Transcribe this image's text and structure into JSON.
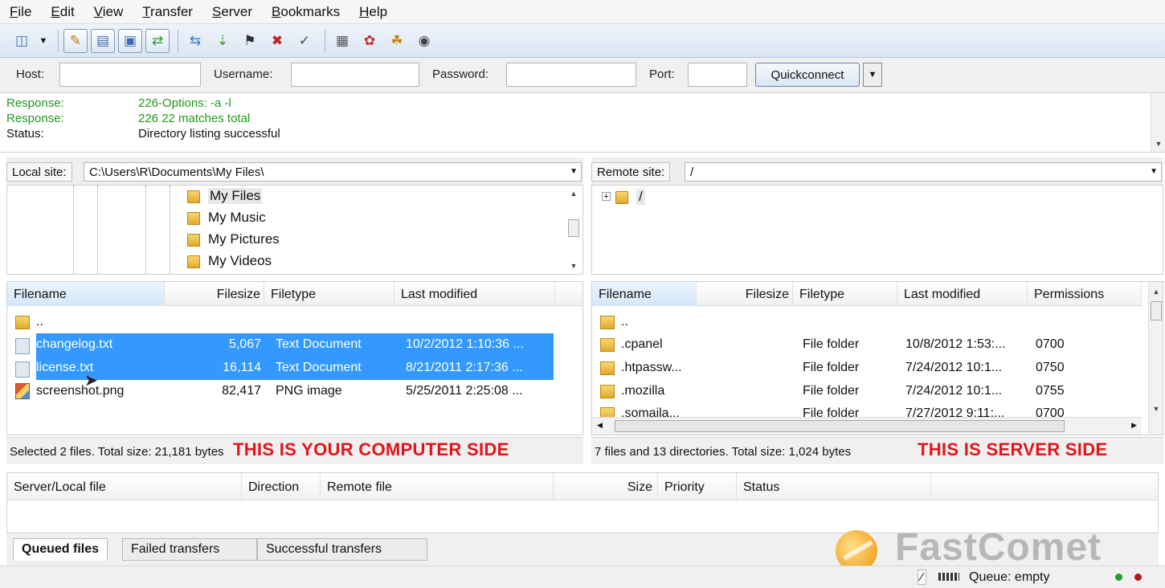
{
  "menu": [
    "File",
    "Edit",
    "View",
    "Transfer",
    "Server",
    "Bookmarks",
    "Help"
  ],
  "toolbar": {
    "icons": [
      "site-manager-icon",
      "dropdown-arrow-icon",
      "toggle-log-icon",
      "toggle-local-tree-icon",
      "toggle-remote-tree-icon",
      "toggle-queue-icon",
      "refresh-icon",
      "process-queue-icon",
      "cancel-icon",
      "disconnect-icon",
      "reconnect-icon",
      "directory-comparison-icon",
      "sync-browse-icon",
      "filter-icon",
      "search-icon"
    ]
  },
  "quickconnect": {
    "host_label": "Host:",
    "username_label": "Username:",
    "password_label": "Password:",
    "port_label": "Port:",
    "host_value": "",
    "username_value": "",
    "password_value": "",
    "port_value": "",
    "button_label": "Quickconnect"
  },
  "log": [
    {
      "type": "Response:",
      "message": "226-Options: -a -l",
      "color": "#1f9a1f"
    },
    {
      "type": "Response:",
      "message": "226 22 matches total",
      "color": "#1f9a1f"
    },
    {
      "type": "Status:",
      "message": "Directory listing successful",
      "color": "#111111"
    }
  ],
  "local": {
    "site_label": "Local site:",
    "path": "C:\\Users\\R\\Documents\\My Files\\",
    "tree": [
      "My Files",
      "My Music",
      "My Pictures",
      "My Videos"
    ],
    "columns": [
      "Filename",
      "Filesize",
      "Filetype",
      "Last modified"
    ],
    "files": [
      {
        "name": "..",
        "size": "",
        "type": "",
        "modified": ""
      },
      {
        "name": "changelog.txt",
        "size": "5,067",
        "type": "Text Document",
        "modified": "10/2/2012 1:10:36 ..."
      },
      {
        "name": "license.txt",
        "size": "16,114",
        "type": "Text Document",
        "modified": "8/21/2011 2:17:36 ..."
      },
      {
        "name": "screenshot.png",
        "size": "82,417",
        "type": "PNG image",
        "modified": "5/25/2011 2:25:08 ..."
      }
    ],
    "status": "Selected 2 files. Total size: 21,181 bytes",
    "note": "THIS IS YOUR COMPUTER SIDE"
  },
  "remote": {
    "site_label": "Remote site:",
    "path": "/",
    "tree_root": "/",
    "columns": [
      "Filename",
      "Filesize",
      "Filetype",
      "Last modified",
      "Permissions"
    ],
    "files": [
      {
        "name": "..",
        "size": "",
        "type": "",
        "modified": "",
        "perms": ""
      },
      {
        "name": ".cpanel",
        "size": "",
        "type": "File folder",
        "modified": "10/8/2012 1:53:...",
        "perms": "0700"
      },
      {
        "name": ".htpassw...",
        "size": "",
        "type": "File folder",
        "modified": "7/24/2012 10:1...",
        "perms": "0750"
      },
      {
        "name": ".mozilla",
        "size": "",
        "type": "File folder",
        "modified": "7/24/2012 10:1...",
        "perms": "0755"
      },
      {
        "name": ".somaila...",
        "size": "",
        "type": "File folder",
        "modified": "7/27/2012 9:11:...",
        "perms": "0700"
      }
    ],
    "status": "7 files and 13 directories. Total size: 1,024 bytes",
    "note": "THIS IS SERVER SIDE"
  },
  "queue": {
    "columns": [
      "Server/Local file",
      "Direction",
      "Remote file",
      "Size",
      "Priority",
      "Status"
    ],
    "tabs": [
      "Queued files",
      "Failed transfers",
      "Successful transfers"
    ],
    "status": "Queue: empty"
  },
  "watermark": "FastComet",
  "colors": {
    "selection": "#3399ff",
    "note_red": "#e4141b",
    "log_green": "#1f9a1f"
  }
}
